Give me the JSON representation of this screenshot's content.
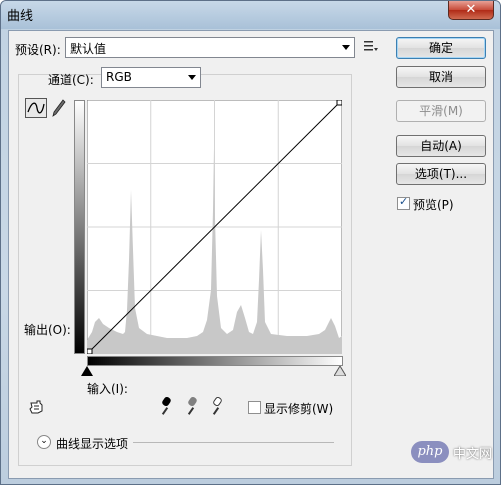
{
  "window": {
    "title": "曲线",
    "close_glyph": "✕"
  },
  "preset": {
    "label": "预设(R):",
    "value": "默认值"
  },
  "channel": {
    "label": "通道(C):",
    "value": "RGB"
  },
  "curve": {
    "output_label": "输出(O):",
    "input_label": "输入(I):"
  },
  "buttons": {
    "ok": "确定",
    "cancel": "取消",
    "smooth": "平滑(M)",
    "auto": "自动(A)",
    "options": "选项(T)..."
  },
  "preview": {
    "label": "预览(P)",
    "checked": true
  },
  "show_clipping": {
    "label": "显示修剪(W)",
    "checked": false
  },
  "curve_display_options": {
    "label": "曲线显示选项"
  },
  "watermark": {
    "text": "中文网",
    "logo": "php"
  },
  "colors": {
    "accent": "#3c7fb1",
    "histogram": "#c8c8c8"
  }
}
